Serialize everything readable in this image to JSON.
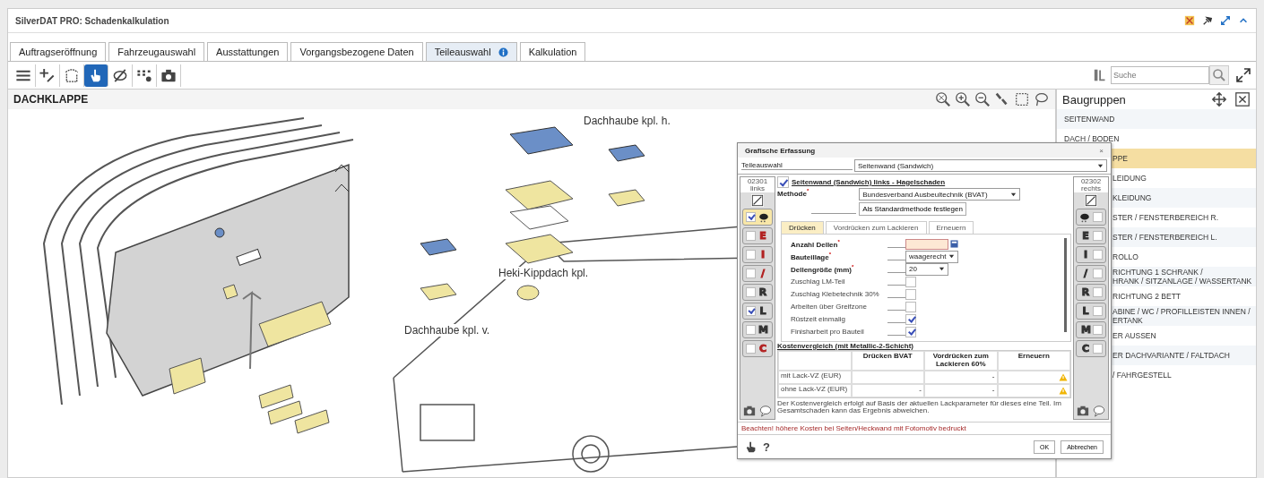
{
  "window": {
    "title": "SilverDAT PRO: Schadenkalkulation"
  },
  "tabs": [
    {
      "label": "Auftragseröffnung",
      "selected": false,
      "info": false
    },
    {
      "label": "Fahrzeugauswahl",
      "selected": false,
      "info": false
    },
    {
      "label": "Ausstattungen",
      "selected": false,
      "info": false
    },
    {
      "label": "Vorgangsbezogene Daten",
      "selected": false,
      "info": false
    },
    {
      "label": "Teileauswahl",
      "selected": true,
      "info": true
    },
    {
      "label": "Kalkulation",
      "selected": false,
      "info": false
    }
  ],
  "toolbar": {
    "tools": [
      {
        "selected": false
      },
      {
        "selected": false
      },
      {
        "selected": false
      },
      {
        "selected": true
      },
      {
        "selected": false
      },
      {
        "selected": false
      },
      {
        "selected": false
      }
    ],
    "search": {
      "placeholder": "Suche"
    }
  },
  "canvas": {
    "title": "DACHKLAPPE",
    "labels": [
      {
        "text": "Dachhaube kpl. h."
      },
      {
        "text": "Heki-Kippdach kpl."
      },
      {
        "text": "Dachhaube kpl. v."
      }
    ]
  },
  "sidebar": {
    "title": "Baugruppen",
    "items": [
      {
        "lines": [
          "SEITENWAND"
        ],
        "covered": false,
        "selected": false
      },
      {
        "lines": [
          "DACH / BODEN"
        ],
        "covered": false,
        "selected": false
      },
      {
        "lines": [
          "PPE"
        ],
        "covered": true,
        "selected": true
      },
      {
        "lines": [
          "LEIDUNG"
        ],
        "covered": true,
        "selected": false
      },
      {
        "lines": [
          "KLEIDUNG"
        ],
        "covered": true,
        "selected": false
      },
      {
        "lines": [
          "STER / FENSTERBEREICH R."
        ],
        "covered": true,
        "selected": false
      },
      {
        "lines": [
          "STER / FENSTERBEREICH L."
        ],
        "covered": true,
        "selected": false
      },
      {
        "lines": [
          "ROLLO"
        ],
        "covered": true,
        "selected": false
      },
      {
        "lines": [
          "RICHTUNG 1 SCHRANK /",
          "HRANK / SITZANLAGE / WASSERTANK"
        ],
        "covered": true,
        "selected": false
      },
      {
        "lines": [
          "RICHTUNG 2 BETT"
        ],
        "covered": true,
        "selected": false
      },
      {
        "lines": [
          "ABINE / WC / PROFILLEISTEN INNEN /",
          "ERTANK"
        ],
        "covered": true,
        "selected": false
      },
      {
        "lines": [
          "ER AUSSEN"
        ],
        "covered": true,
        "selected": false
      },
      {
        "lines": [
          "ER DACHVARIANTE / FALTDACH"
        ],
        "covered": true,
        "selected": false
      },
      {
        "lines": [
          "/ FAHRGESTELL"
        ],
        "covered": true,
        "selected": false
      }
    ]
  },
  "dialog": {
    "title": "Grafische Erfassung",
    "close": "×",
    "part_label": "Teileauswahl",
    "part_value": "Seitenwand (Sandwich)",
    "left_column": {
      "code": "02301",
      "side": "links",
      "buttons": [
        {
          "kind": "hail",
          "checked": true,
          "selected": true
        },
        {
          "kind": "letter",
          "letter": "E",
          "color": "#b22222",
          "checked": false,
          "selected": false
        },
        {
          "kind": "letter",
          "letter": "I",
          "color": "#b22222",
          "checked": false,
          "selected": false
        },
        {
          "kind": "letter",
          "letter": "/",
          "color": "#b22222",
          "checked": false,
          "selected": false
        },
        {
          "kind": "letter",
          "letter": "R",
          "color": "#333333",
          "checked": false,
          "selected": false
        },
        {
          "kind": "letter",
          "letter": "L",
          "color": "#333333",
          "checked": true,
          "selected": false
        },
        {
          "kind": "letter",
          "letter": "M",
          "color": "#333333",
          "checked": false,
          "selected": false
        },
        {
          "kind": "letter",
          "letter": "C",
          "color": "#b22222",
          "checked": false,
          "selected": false
        }
      ]
    },
    "right_column": {
      "code": "02302",
      "side": "rechts",
      "buttons": [
        {
          "kind": "hail",
          "checked": false,
          "selected": false
        },
        {
          "kind": "letter",
          "letter": "E",
          "color": "#333333",
          "checked": false,
          "selected": false
        },
        {
          "kind": "letter",
          "letter": "I",
          "color": "#333333",
          "checked": false,
          "selected": false
        },
        {
          "kind": "letter",
          "letter": "/",
          "color": "#333333",
          "checked": false,
          "selected": false
        },
        {
          "kind": "letter",
          "letter": "R",
          "color": "#333333",
          "checked": false,
          "selected": false
        },
        {
          "kind": "letter",
          "letter": "L",
          "color": "#333333",
          "checked": false,
          "selected": false
        },
        {
          "kind": "letter",
          "letter": "M",
          "color": "#333333",
          "checked": false,
          "selected": false
        },
        {
          "kind": "letter",
          "letter": "C",
          "color": "#333333",
          "checked": false,
          "selected": false
        }
      ]
    },
    "damage": {
      "checked": true,
      "text": "Seitenwand (Sandwich) links - Hagelschaden"
    },
    "method": {
      "label": "Methode",
      "required": "*",
      "value": "Bundesverband Ausbeultechnik (BVAT)",
      "button": "Als Standardmethode festlegen"
    },
    "tabs": [
      {
        "label": "Drücken",
        "selected": true
      },
      {
        "label": "Vordrücken zum Lackieren",
        "selected": false
      },
      {
        "label": "Erneuern",
        "selected": false
      }
    ],
    "fields": [
      {
        "kind": "number",
        "label": "Anzahl Dellen",
        "required": "*"
      },
      {
        "kind": "select",
        "label": "Bauteillage",
        "required": "*",
        "value": "waagerecht"
      },
      {
        "kind": "select",
        "label": "Dellengröße (mm)",
        "required": "*",
        "value": "20"
      },
      {
        "kind": "checkbox",
        "label": "Zuschlag LM-Teil",
        "checked": false
      },
      {
        "kind": "checkbox",
        "label": "Zuschlag Klebetechnik 30%",
        "checked": false
      },
      {
        "kind": "checkbox",
        "label": "Arbeiten über Greifzone",
        "checked": false
      },
      {
        "kind": "checkbox",
        "label": "Rüstzeit einmalig",
        "checked": true
      },
      {
        "kind": "checkbox",
        "label": "Finisharbeit pro Bauteil",
        "checked": true
      }
    ],
    "comparison": {
      "title": "Kostenvergleich (mit Metallic-2-Schicht)",
      "columns": [
        "Drücken BVAT",
        "Vordrücken zum Lackieren 60%",
        "Erneuern"
      ],
      "rows": [
        {
          "label": "mit Lack-VZ (EUR)",
          "cells": [
            {
              "kind": "empty"
            },
            {
              "kind": "text",
              "text": "-"
            },
            {
              "kind": "warning"
            }
          ]
        },
        {
          "label": "ohne Lack-VZ (EUR)",
          "cells": [
            {
              "kind": "text",
              "text": "-"
            },
            {
              "kind": "text",
              "text": "-"
            },
            {
              "kind": "warning"
            }
          ]
        }
      ],
      "note": "Der Kostenvergleich erfolgt auf Basis der aktuellen Lackparameter für dieses eine Teil. Im Gesamtschaden kann das Ergebnis abweichen."
    },
    "warning": "Beachten! höhere Kosten bei Seiten/Heckwand mit Fotomotiv bedruckt",
    "help": "?",
    "buttons": [
      "OK",
      "Abbrechen"
    ]
  }
}
